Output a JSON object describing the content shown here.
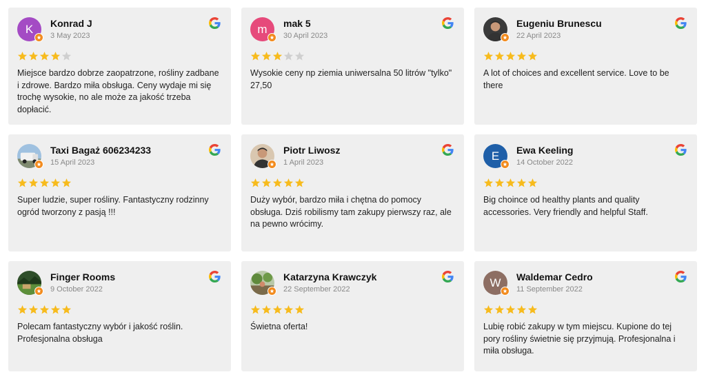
{
  "colors": {
    "card_bg": "#efefef",
    "star_filled": "#f7bb1d",
    "star_empty": "#cfcfcf",
    "badge": "#f28b1e"
  },
  "reviews": [
    {
      "name": "Konrad J",
      "date": "3 May 2023",
      "rating": 4,
      "avatar": {
        "type": "letter",
        "letter": "K",
        "color": "#a44bc4"
      },
      "text": "Miejsce bardzo dobrze zaopatrzone, rośliny zadbane i zdrowe. Bardzo miła obsługa. Ceny wydaje mi się trochę wysokie, no ale może za jakość trzeba dopłacić."
    },
    {
      "name": "mak 5",
      "date": "30 April 2023",
      "rating": 3,
      "avatar": {
        "type": "letter",
        "letter": "m",
        "color": "#e64a7b"
      },
      "text": "Wysokie ceny np ziemia uniwersalna 50 litrów \"tylko\" 27,50"
    },
    {
      "name": "Eugeniu Brunescu",
      "date": "22 April 2023",
      "rating": 5,
      "avatar": {
        "type": "photo",
        "icon": "person-photo",
        "color": "#3a3a3a"
      },
      "text": "A lot of choices and excellent service. Love to be there"
    },
    {
      "name": "Taxi Bagaż 606234233",
      "date": "15 April 2023",
      "rating": 5,
      "avatar": {
        "type": "photo",
        "icon": "van-photo",
        "color": "#6a8fb8"
      },
      "text": "Super ludzie, super rośliny. Fantastyczny rodzinny ogród tworzony z pasją !!!"
    },
    {
      "name": "Piotr Liwosz",
      "date": "1 April 2023",
      "rating": 5,
      "avatar": {
        "type": "photo",
        "icon": "person-photo",
        "color": "#d9c7b0"
      },
      "text": "Duży wybór, bardzo miła i chętna do pomocy obsługa. Dziś robilismy tam zakupy pierwszy raz, ale na pewno wrócimy."
    },
    {
      "name": "Ewa Keeling",
      "date": "14 October 2022",
      "rating": 5,
      "avatar": {
        "type": "letter",
        "letter": "E",
        "color": "#1f5fa8"
      },
      "text": "Big choince od healthy plants and quality accessories. Very friendly and helpful Staff."
    },
    {
      "name": "Finger Rooms",
      "date": "9 October 2022",
      "rating": 5,
      "avatar": {
        "type": "photo",
        "icon": "landscape-photo",
        "color": "#3e6a2e"
      },
      "text": "Polecam fantastyczny wybór i jakość roślin. Profesjonalna obsługa"
    },
    {
      "name": "Katarzyna Krawczyk",
      "date": "22 September 2022",
      "rating": 5,
      "avatar": {
        "type": "photo",
        "icon": "garden-photo",
        "color": "#8aa86a"
      },
      "text": "Świetna oferta!"
    },
    {
      "name": "Waldemar Cedro",
      "date": "11 September 2022",
      "rating": 5,
      "avatar": {
        "type": "letter",
        "letter": "W",
        "color": "#8d6e63"
      },
      "text": "Lubię robić zakupy w tym miejscu. Kupione do tej pory rośliny świetnie się przyjmują. Profesjonalna i miła obsługa."
    }
  ]
}
